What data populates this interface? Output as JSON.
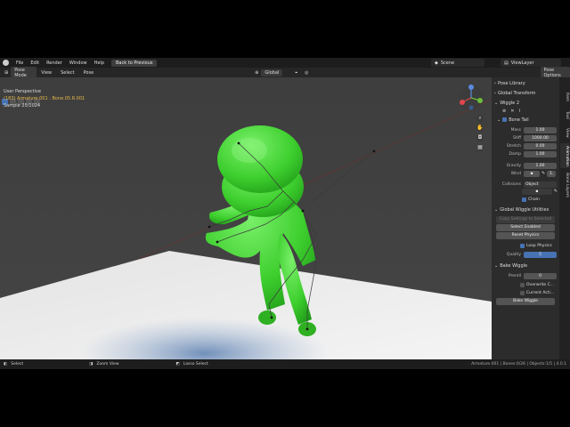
{
  "topbar": {
    "menus": [
      "File",
      "Edit",
      "Render",
      "Window",
      "Help"
    ],
    "back_button": "Back to Previous",
    "scene": "Scene",
    "view_layer": "ViewLayer"
  },
  "header": {
    "mode": "Pose Mode",
    "menus": [
      "View",
      "Select",
      "Pose"
    ],
    "orientation": "Global",
    "pose_options": "Pose Options"
  },
  "viewport": {
    "perspective": "User Perspective",
    "selection": "(183) Armature.001 : Bone.05.R.001",
    "sample": "Sample 25/1024"
  },
  "npanel": {
    "pose_library": "Pose Library",
    "global_transform": "Global Transform",
    "wiggle2": "Wiggle 2",
    "bone_tail": "Bone Tail",
    "props": [
      {
        "label": "Mass",
        "value": "1.00"
      },
      {
        "label": "Stiff",
        "value": "1000.00"
      },
      {
        "label": "Stretch",
        "value": "0.00"
      },
      {
        "label": "Damp",
        "value": "1.00"
      }
    ],
    "gravity_label": "Gravity",
    "gravity_value": "1.00",
    "wind_label": "Wind",
    "wind_value": "1.",
    "collisions_label": "Collisions",
    "collisions_value": "Object",
    "chain": "Chain",
    "global_utils": "Global Wiggle Utilities",
    "copy_settings": "Copy Settings to Selected",
    "select_enabled": "Select Enabled",
    "reset_physics": "Reset Physics",
    "loop_physics": "Loop Physics",
    "quality_label": "Quality",
    "quality_value": "5",
    "bake_wiggle_section": "Bake Wiggle",
    "preroll_label": "Preroll",
    "preroll_value": "0",
    "overwrite": "Overwrite C...",
    "current_action": "Current Acti...",
    "bake_button": "Bake Wiggle"
  },
  "tabs": [
    "Item",
    "Tool",
    "View",
    "Animation",
    "Bone Layers"
  ],
  "status": {
    "select": "Select",
    "zoom": "Zoom View",
    "lasso": "Lasso Select",
    "stats": "Armature.001 | Bones:0/26 | Objects:1/5 | 4.0.1"
  },
  "colors": {
    "character": "#3ecf2e",
    "accent": "#4772b3",
    "highlight": "#e8b74a"
  }
}
